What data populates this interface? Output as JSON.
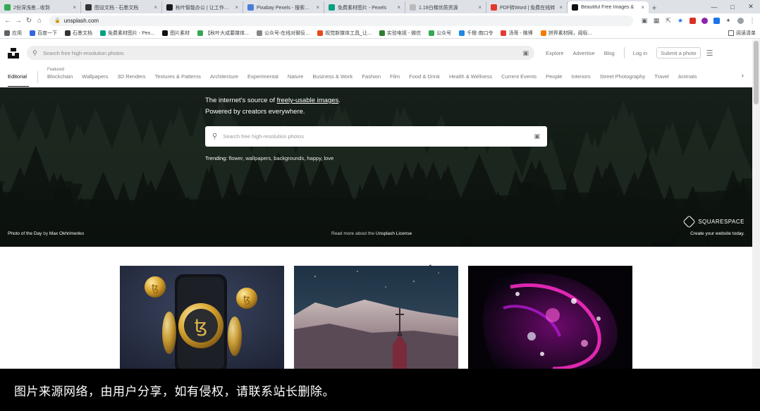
{
  "browser": {
    "tabs": [
      {
        "label": "2份深浅差...收到",
        "color": "#34a853",
        "active": false
      },
      {
        "label": "图设文档 - 石墨文档",
        "color": "#333333",
        "active": false
      },
      {
        "label": "秋叶智能办公 | 让工作轻松",
        "color": "#1a1a1a",
        "active": false
      },
      {
        "label": "Pixabay Pexels - 搜索结果",
        "color": "#4a7dd8",
        "active": false
      },
      {
        "label": "免费素材图片 - Pexels",
        "color": "#05a081",
        "active": false
      },
      {
        "label": "1.19白梯优质资源",
        "color": "#bbbbbb",
        "active": false
      },
      {
        "label": "PDF转Word | 免费在线转",
        "color": "#e2382d",
        "active": false
      },
      {
        "label": "Beautiful Free Images &",
        "color": "#111111",
        "active": true
      }
    ],
    "url": "unsplash.com"
  },
  "bookmarks": {
    "items": [
      {
        "label": "应用",
        "color": "#5f6368"
      },
      {
        "label": "百度一下",
        "color": "#3168e0"
      },
      {
        "label": "石墨文档",
        "color": "#333333"
      },
      {
        "label": "免费素材图片 - Pex...",
        "color": "#05a081"
      },
      {
        "label": "图片素材",
        "color": "#111111"
      },
      {
        "label": "【秋叶大成要媒体...",
        "color": "#34a853"
      },
      {
        "label": "公众号-在线对聊反...",
        "color": "#888888"
      },
      {
        "label": "视觉新媒体工具_让...",
        "color": "#e64a19"
      },
      {
        "label": "实验电视 - 微信",
        "color": "#2e7d32"
      },
      {
        "label": "公众号",
        "color": "#34a853"
      },
      {
        "label": "千橙·南口令",
        "color": "#1e88e5"
      },
      {
        "label": "汤哥 - 微博",
        "color": "#e53935"
      },
      {
        "label": "拼界素材网，阅标...",
        "color": "#f57c00"
      }
    ],
    "reading_list": "阅读清单"
  },
  "header": {
    "search_placeholder": "Search free high-resolution photos",
    "nav": [
      "Explore",
      "Advertise",
      "Blog"
    ],
    "login": "Log in",
    "submit": "Submit a photo"
  },
  "topics": {
    "editorial": "Editorial",
    "featured_label": "Featured",
    "items": [
      "Blockchain",
      "Wallpapers",
      "3D Renders",
      "Textures & Patterns",
      "Architecture",
      "Experimental",
      "Nature",
      "Business & Work",
      "Fashion",
      "Film",
      "Food & Drink",
      "Health & Wellness",
      "Current Events",
      "People",
      "Interiors",
      "Street Photography",
      "Travel",
      "Animals"
    ]
  },
  "hero": {
    "line1_pre": "The internet's source of ",
    "line1_link": "freely-usable images",
    "line1_post": ".",
    "line2": "Powered by creators everywhere.",
    "search_placeholder": "Search free high-resolution photos",
    "trending_label": "Trending:",
    "trending_items": "flower, wallpapers, backgrounds, happy, love",
    "credit_pre": "Photo of the Day",
    "credit_by": "by",
    "credit_author": "Max Okhrimenko",
    "license_pre": "Read more about the",
    "license_link": "Unsplash License",
    "sponsor": "SQUARESPACE",
    "sponsor_tagline": "Create your website today."
  },
  "banner": {
    "text": "图片来源网络，由用户分享，如有侵权，请联系站长删除。"
  }
}
